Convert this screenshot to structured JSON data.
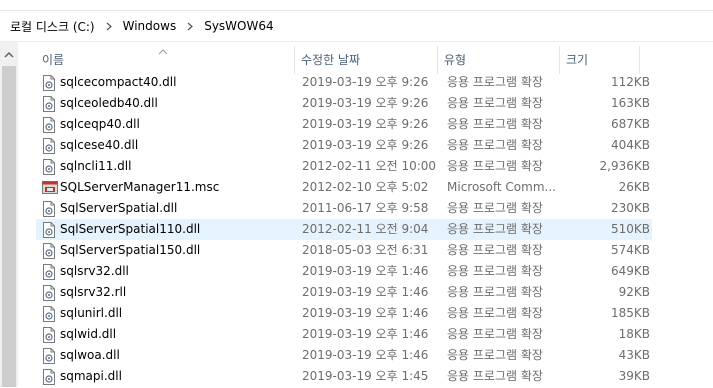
{
  "breadcrumb": {
    "items": [
      "로컬 디스크 (C:)",
      "Windows",
      "SysWOW64"
    ]
  },
  "columns": {
    "name": "이름",
    "date": "수정한 날짜",
    "type": "유형",
    "size": "크기"
  },
  "files": [
    {
      "name": "sqlcecompact40.dll",
      "date": "2019-03-19 오후 9:26",
      "type": "응용 프로그램 확장",
      "size": "112KB",
      "icon": "dll-file-icon"
    },
    {
      "name": "sqlceoledb40.dll",
      "date": "2019-03-19 오후 9:26",
      "type": "응용 프로그램 확장",
      "size": "163KB",
      "icon": "dll-file-icon"
    },
    {
      "name": "sqlceqp40.dll",
      "date": "2019-03-19 오후 9:26",
      "type": "응용 프로그램 확장",
      "size": "687KB",
      "icon": "dll-file-icon"
    },
    {
      "name": "sqlcese40.dll",
      "date": "2019-03-19 오후 9:26",
      "type": "응용 프로그램 확장",
      "size": "404KB",
      "icon": "dll-file-icon"
    },
    {
      "name": "sqlncli11.dll",
      "date": "2012-02-11 오전 10:00",
      "type": "응용 프로그램 확장",
      "size": "2,936KB",
      "icon": "dll-file-icon"
    },
    {
      "name": "SQLServerManager11.msc",
      "date": "2012-02-10 오후 5:02",
      "type": "Microsoft Comm...",
      "size": "26KB",
      "icon": "msc-file-icon"
    },
    {
      "name": "SqlServerSpatial.dll",
      "date": "2011-06-17 오후 9:58",
      "type": "응용 프로그램 확장",
      "size": "230KB",
      "icon": "dll-file-icon"
    },
    {
      "name": "SqlServerSpatial110.dll",
      "date": "2012-02-11 오전 9:04",
      "type": "응용 프로그램 확장",
      "size": "510KB",
      "icon": "dll-file-icon",
      "selected": true
    },
    {
      "name": "SqlServerSpatial150.dll",
      "date": "2018-05-03 오전 6:31",
      "type": "응용 프로그램 확장",
      "size": "574KB",
      "icon": "dll-file-icon"
    },
    {
      "name": "sqlsrv32.dll",
      "date": "2019-03-19 오후 1:46",
      "type": "응용 프로그램 확장",
      "size": "649KB",
      "icon": "dll-file-icon"
    },
    {
      "name": "sqlsrv32.rll",
      "date": "2019-03-19 오후 1:46",
      "type": "응용 프로그램 확장",
      "size": "92KB",
      "icon": "dll-file-icon"
    },
    {
      "name": "sqlunirl.dll",
      "date": "2019-03-19 오후 1:46",
      "type": "응용 프로그램 확장",
      "size": "185KB",
      "icon": "dll-file-icon"
    },
    {
      "name": "sqlwid.dll",
      "date": "2019-03-19 오후 1:46",
      "type": "응용 프로그램 확장",
      "size": "18KB",
      "icon": "dll-file-icon"
    },
    {
      "name": "sqlwoa.dll",
      "date": "2019-03-19 오후 1:46",
      "type": "응용 프로그램 확장",
      "size": "43KB",
      "icon": "dll-file-icon"
    },
    {
      "name": "sqmapi.dll",
      "date": "2019-03-19 오후 1:45",
      "type": "응용 프로그램 확장",
      "size": "39KB",
      "icon": "dll-file-icon"
    }
  ],
  "colors": {
    "selection": "#e5f3ff",
    "header_text": "#4c607a",
    "meta_text": "#6d6d6d"
  }
}
